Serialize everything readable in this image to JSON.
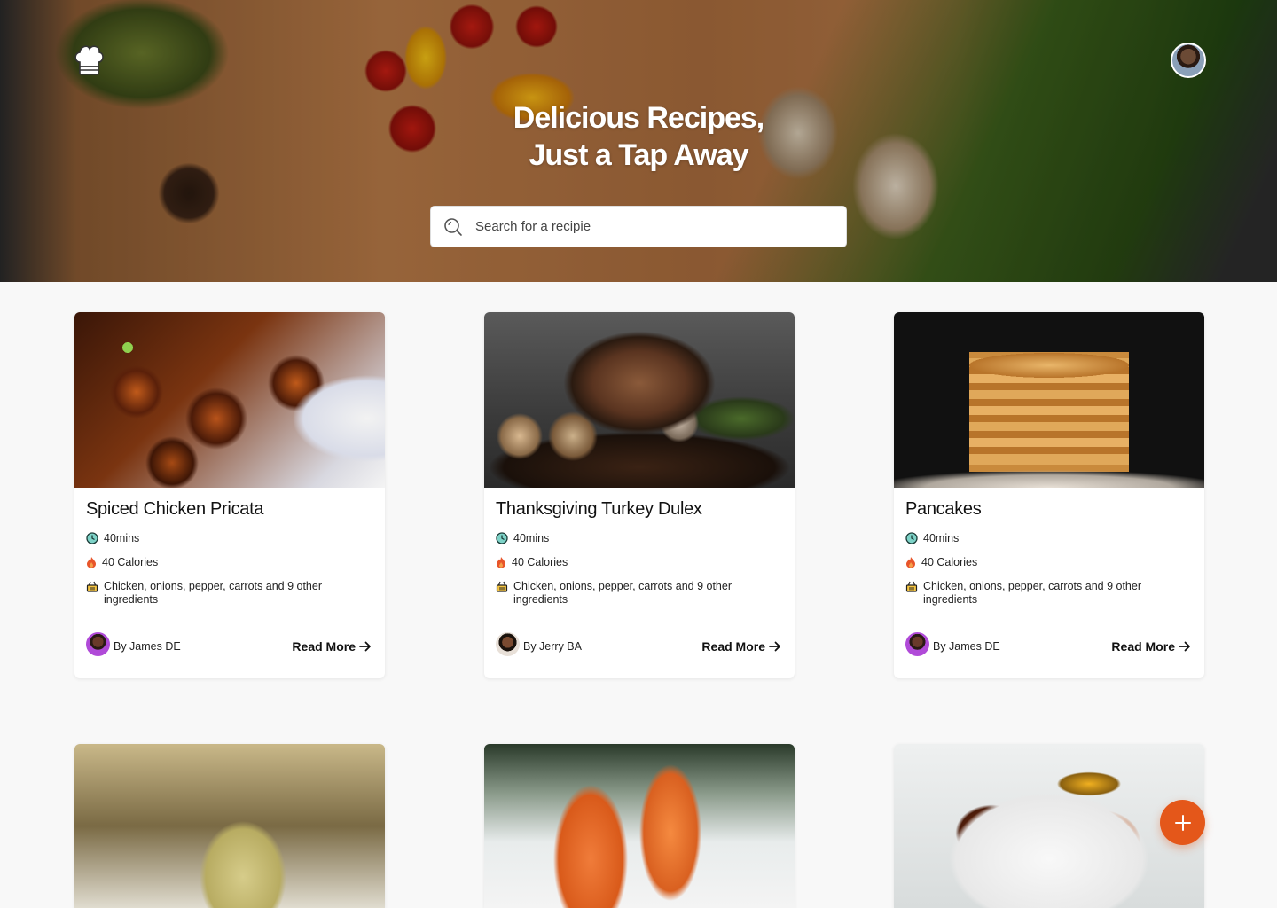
{
  "hero": {
    "title_line1": "Delicious Recipes,",
    "title_line2": "Just a Tap Away",
    "search_placeholder": "Search for a recipie"
  },
  "icons": {
    "logo": "chef-hat-icon",
    "search": "search-icon",
    "time": "clock-icon",
    "calories": "flame-icon",
    "ingredients": "basket-icon",
    "read_more": "arrow-right-icon",
    "fab": "plus-icon"
  },
  "colors": {
    "accent": "#e4571a",
    "clock": "#3ab0a4",
    "flame": "#e8552a"
  },
  "recipes": [
    {
      "title": "Spiced Chicken Pricata",
      "time": "40mins",
      "calories": "40 Calories",
      "ingredients": "Chicken, onions, pepper, carrots and 9 other ingredients",
      "author": "By James DE",
      "read_more": "Read More"
    },
    {
      "title": "Thanksgiving Turkey Dulex",
      "time": "40mins",
      "calories": "40 Calories",
      "ingredients": "Chicken, onions, pepper, carrots and 9 other ingredients",
      "author": "By Jerry BA",
      "read_more": "Read More"
    },
    {
      "title": "Pancakes",
      "time": "40mins",
      "calories": "40 Calories",
      "ingredients": "Chicken, onions, pepper, carrots and 9 other ingredients",
      "author": "By James DE",
      "read_more": "Read More"
    }
  ]
}
